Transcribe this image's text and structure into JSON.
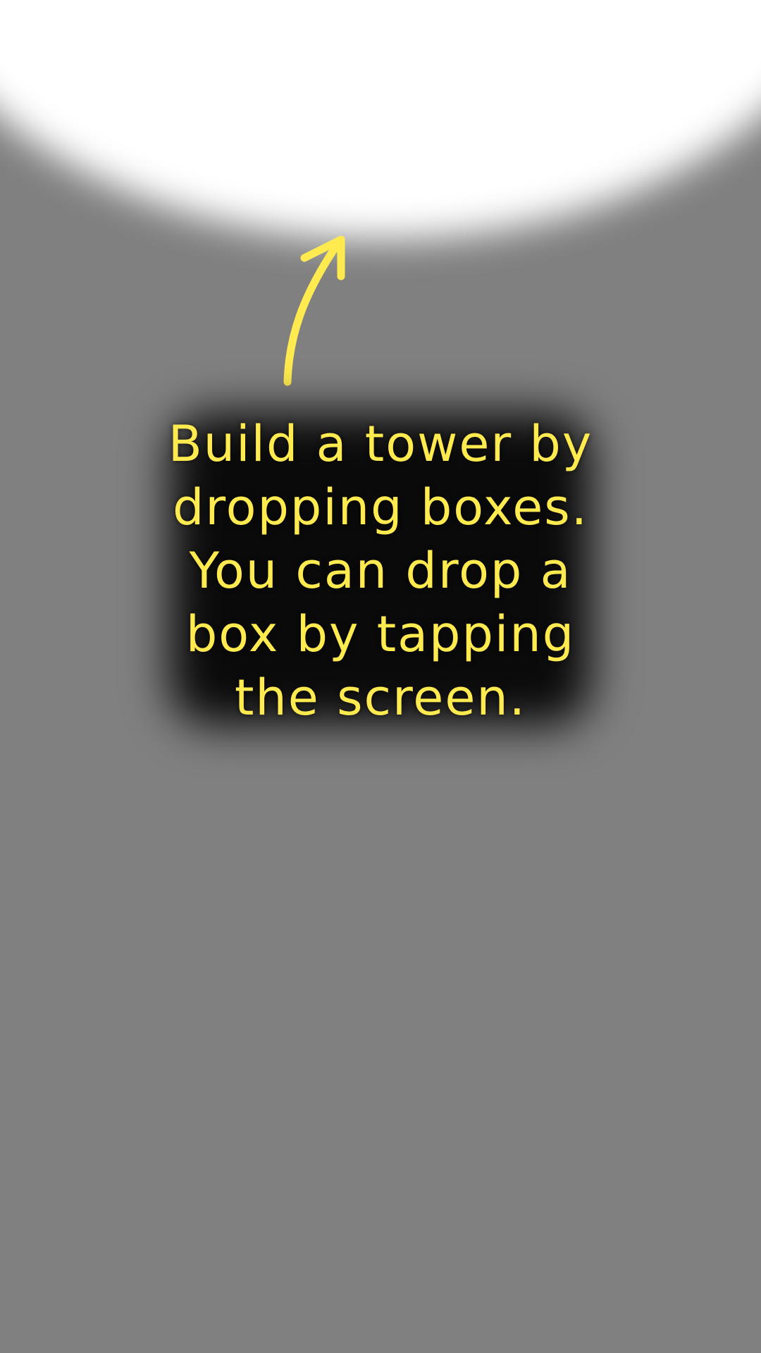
{
  "tutorial": {
    "lines": [
      "Build a tower by",
      "dropping boxes.",
      "You can drop a",
      "box by tapping",
      "the screen."
    ],
    "text_color": "#ffeb4f",
    "arrow_icon": "curved-arrow-up-icon",
    "arrow_color": "#ffeb4f"
  },
  "colors": {
    "background": "#808080",
    "spotlight": "#ffffff",
    "text_backdrop": "#000000"
  }
}
